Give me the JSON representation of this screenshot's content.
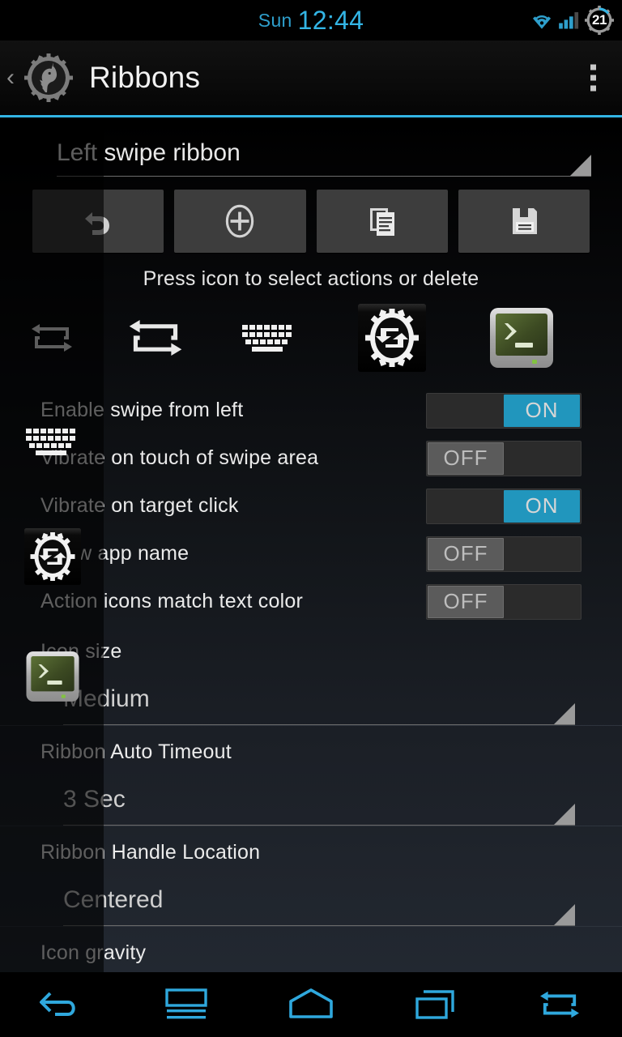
{
  "statusbar": {
    "day": "Sun",
    "time": "12:44",
    "battery_level": "21",
    "icons": [
      "wifi-icon",
      "signal-icon",
      "battery-icon"
    ],
    "accent_color": "#33b5e5"
  },
  "actionbar": {
    "title": "Ribbons",
    "up_glyph": "‹",
    "logo": "unicorn-gear-logo",
    "overflow": "overflow-menu-icon",
    "accent_color": "#33b5e5"
  },
  "ribbon_selector": {
    "value": "Left swipe ribbon"
  },
  "toolbar": {
    "buttons": [
      {
        "name": "undo-button",
        "icon": "undo-icon"
      },
      {
        "name": "add-button",
        "icon": "plus-circle-icon"
      },
      {
        "name": "copy-button",
        "icon": "copy-icon"
      },
      {
        "name": "save-button",
        "icon": "save-floppy-icon"
      }
    ]
  },
  "hint": "Press icon to select actions or delete",
  "action_icons": [
    {
      "name": "swap-icon-small",
      "type": "swap-arrows"
    },
    {
      "name": "swap-icon-large",
      "type": "swap-arrows"
    },
    {
      "name": "keyboard-icon",
      "type": "keyboard"
    },
    {
      "name": "gear-sync-icon",
      "type": "gear-sync"
    },
    {
      "name": "terminal-icon",
      "type": "terminal"
    }
  ],
  "settings": {
    "toggles": [
      {
        "label": "Enable swipe from left",
        "state": "ON"
      },
      {
        "label": "Vibrate on touch of swipe area",
        "state": "OFF"
      },
      {
        "label": "Vibrate on target click",
        "state": "ON"
      },
      {
        "label": "Show app name",
        "state": "OFF"
      },
      {
        "label": "Action icons match text color",
        "state": "OFF"
      }
    ],
    "spinners": [
      {
        "label": "Icon size",
        "value": "Medium"
      },
      {
        "label": "Ribbon Auto Timeout",
        "value": "3 Sec"
      },
      {
        "label": "Ribbon Handle Location",
        "value": "Centered"
      }
    ],
    "clipped_label": "Icon gravity"
  },
  "ribbon_overlay": {
    "icons": [
      {
        "name": "keyboard-icon",
        "type": "keyboard"
      },
      {
        "name": "gear-sync-icon",
        "type": "gear-sync"
      },
      {
        "name": "terminal-icon",
        "type": "terminal"
      }
    ]
  },
  "navbar": {
    "color": "#33b5e5",
    "buttons": [
      {
        "name": "nav-back-button",
        "icon": "back-arrow-icon"
      },
      {
        "name": "nav-menu-button",
        "icon": "menu-icon"
      },
      {
        "name": "nav-home-button",
        "icon": "home-icon"
      },
      {
        "name": "nav-recents-button",
        "icon": "recents-icon"
      },
      {
        "name": "nav-swap-button",
        "icon": "swap-arrows-icon"
      }
    ]
  }
}
